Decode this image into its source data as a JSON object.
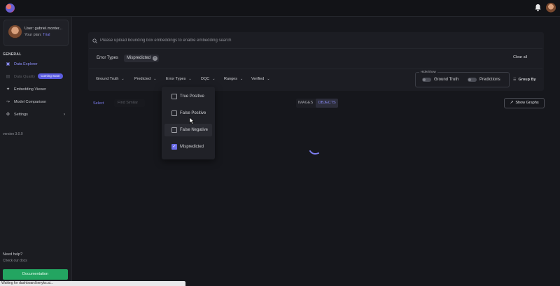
{
  "topbar": {
    "logo_icon": "app-logo",
    "bell_icon": "bell-icon"
  },
  "user": {
    "name": "User: gabriel.monter...",
    "plan_prefix": "Your plan: ",
    "plan": "Trial"
  },
  "sidebar": {
    "section": "GENERAL",
    "items": [
      {
        "label": "Data Explorer",
        "icon": "grid-icon"
      },
      {
        "label": "Data Quality",
        "icon": "check-icon",
        "badge": "Coming Soon"
      },
      {
        "label": "Embedding Viewer",
        "icon": "sparkle-icon"
      },
      {
        "label": "Model Comparison",
        "icon": "chart-icon"
      },
      {
        "label": "Settings",
        "icon": "gear-icon"
      }
    ],
    "version": "version 3.0.0",
    "help_title": "Need help?",
    "help_sub": "Check our docs",
    "doc_button": "Documentation"
  },
  "search": {
    "placeholder": "Please upload bounding box embeddings to enable embedding search"
  },
  "active_filters": {
    "label": "Error Types",
    "value": "Mispredicted",
    "clear_all": "Clear all"
  },
  "filters": [
    "Ground Truth",
    "Predicted",
    "Error Types",
    "DQC",
    "Ranges",
    "Verified"
  ],
  "hide_show": {
    "legend": "Hide/Show",
    "ground_truth": "Ground Truth",
    "predictions": "Predictions"
  },
  "group_by": "Group By",
  "toolbar": {
    "select": "Select",
    "find_similar": "Find Similar",
    "images": "IMAGES",
    "objects": "OBJECTS",
    "show_graphs": "Show Graphs"
  },
  "dropdown": {
    "items": [
      {
        "label": "True Positive",
        "checked": false
      },
      {
        "label": "False Positive",
        "checked": false
      },
      {
        "label": "False Negative",
        "checked": false
      },
      {
        "label": "Mispredicted",
        "checked": true
      }
    ]
  },
  "statusbar": "Waiting for dashboard.tenyks.ai...",
  "colors": {
    "accent": "#6b6ce6",
    "button_green": "#23a561",
    "background": "#16171c"
  }
}
